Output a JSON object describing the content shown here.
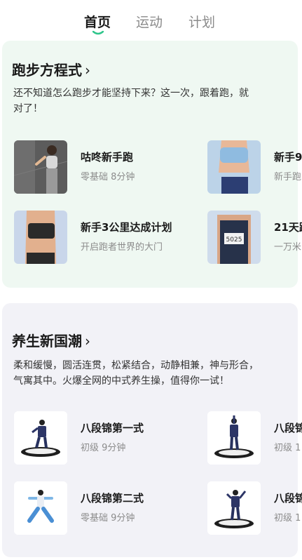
{
  "tabs": [
    {
      "label": "首页",
      "active": true
    },
    {
      "label": "运动",
      "active": false
    },
    {
      "label": "计划",
      "active": false
    }
  ],
  "accent_color": "#2fc58b",
  "running": {
    "title": "跑步方程式",
    "desc_line1": "还不知道怎么跑步才能坚持下来？这一次，跟着跑，就",
    "desc_line2": "对了！",
    "items": [
      {
        "title": "咕咚新手跑",
        "sub": "零基础 8分钟"
      },
      {
        "title": "新手9",
        "sub": "新手跑"
      },
      {
        "title": "新手3公里达成计划",
        "sub": "开启跑者世界的大门"
      },
      {
        "title": "21天跑",
        "sub": "一万米"
      }
    ]
  },
  "health": {
    "title": "养生新国潮",
    "desc_line1": "柔和缓慢，圆活连贯，松紧结合，动静相兼，神与形合，",
    "desc_line2": "气寓其中。火爆全网的中式养生操，值得你一试！",
    "items": [
      {
        "title": "八段锦第一式",
        "sub": "初级 9分钟"
      },
      {
        "title": "八段锦",
        "sub": "初级 1"
      },
      {
        "title": "八段锦第二式",
        "sub": "零基础 9分钟"
      },
      {
        "title": "八段锦",
        "sub": "初级 1"
      }
    ]
  }
}
